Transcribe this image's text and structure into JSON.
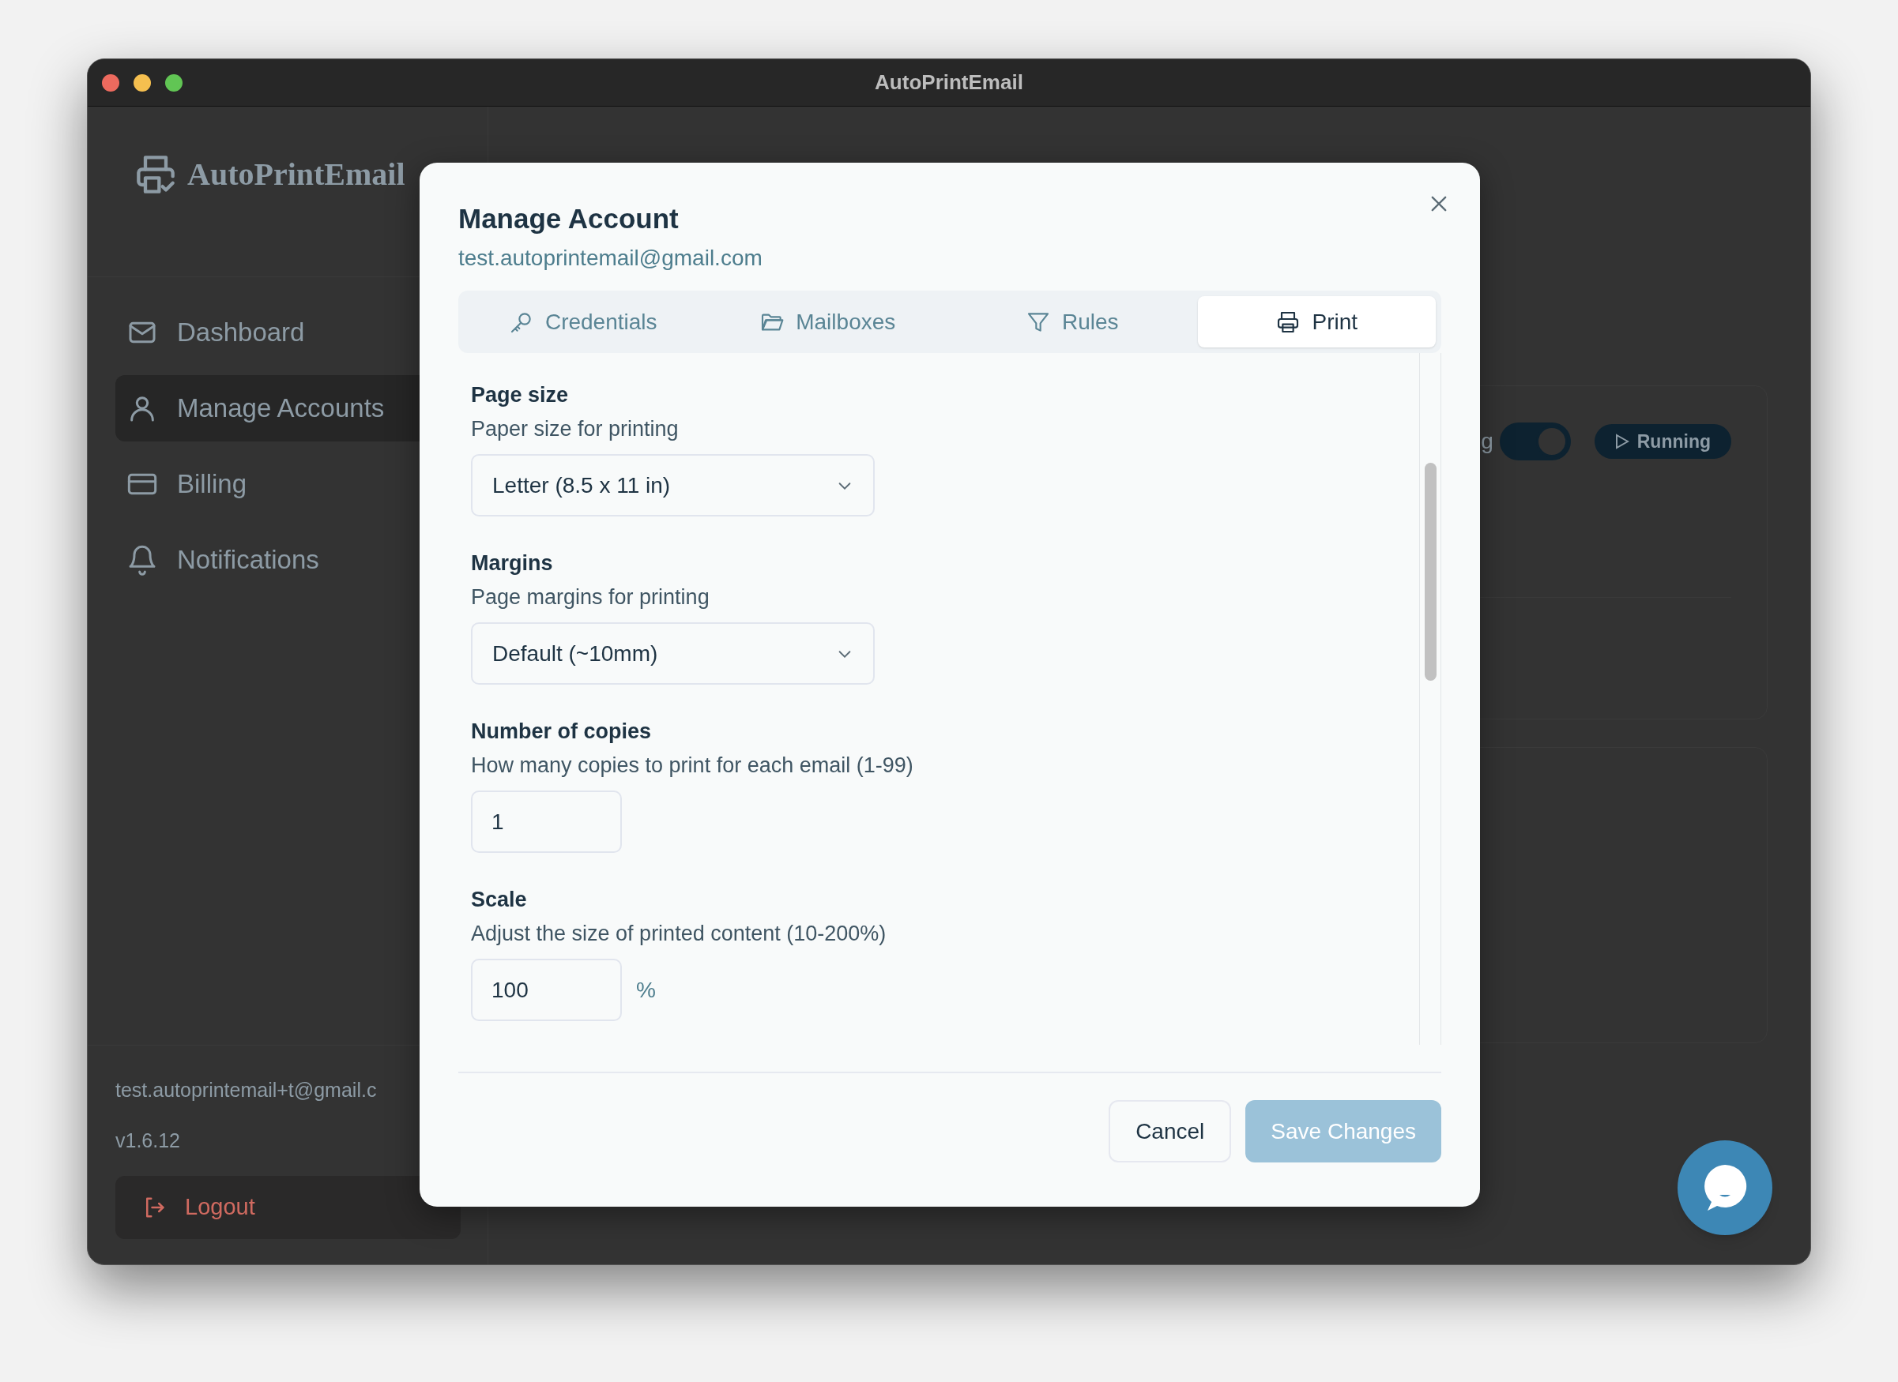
{
  "window": {
    "title": "AutoPrintEmail"
  },
  "sidebar": {
    "logo": "AutoPrintEmail",
    "items": [
      {
        "label": "Dashboard",
        "selected": false
      },
      {
        "label": "Manage Accounts",
        "selected": true
      },
      {
        "label": "Billing",
        "selected": false
      },
      {
        "label": "Notifications",
        "selected": false
      }
    ],
    "account_email": "test.autoprintemail+t@gmail.c",
    "version": "v1.6.12",
    "logout": "Logout"
  },
  "background_card": {
    "label_fragment": "g",
    "toggle_on": true,
    "status": "Running"
  },
  "dialog": {
    "title": "Manage Account",
    "subtitle": "test.autoprintemail@gmail.com",
    "tabs": [
      {
        "label": "Credentials",
        "selected": false
      },
      {
        "label": "Mailboxes",
        "selected": false
      },
      {
        "label": "Rules",
        "selected": false
      },
      {
        "label": "Print",
        "selected": true
      }
    ],
    "fields": [
      {
        "kind": "select",
        "label": "Page size",
        "description": "Paper size for printing",
        "value": "Letter (8.5 x 11 in)"
      },
      {
        "kind": "select",
        "label": "Margins",
        "description": "Page margins for printing",
        "value": "Default (~10mm)"
      },
      {
        "kind": "number",
        "label": "Number of copies",
        "description": "How many copies to print for each email (1-99)",
        "value": "1"
      },
      {
        "kind": "number",
        "label": "Scale",
        "description": "Adjust the size of printed content (10-200%)",
        "value": "100",
        "suffix": "%"
      }
    ],
    "buttons": [
      {
        "label": "Cancel",
        "kind": "secondary",
        "disabled": false
      },
      {
        "label": "Save Changes",
        "kind": "primary",
        "disabled": true
      }
    ]
  }
}
